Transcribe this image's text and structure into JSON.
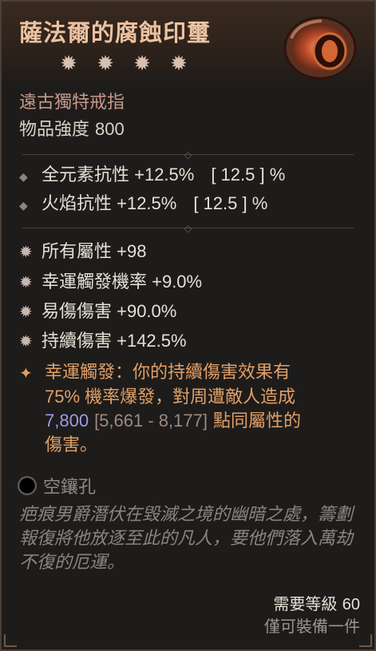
{
  "item": {
    "name": "薩法爾的腐蝕印璽",
    "star_count": 4,
    "type": "遠古獨特戒指",
    "power_label": "物品強度",
    "power_value": "800"
  },
  "implicits": [
    {
      "text": "全元素抗性 +12.5%",
      "range": "[ 12.5 ] %"
    },
    {
      "text": "火焰抗性 +12.5%",
      "range": "[ 12.5 ] %"
    }
  ],
  "affixes": [
    {
      "text": "所有屬性 +98"
    },
    {
      "text": "幸運觸發機率 +9.0%"
    },
    {
      "text": "易傷傷害 +90.0%"
    },
    {
      "text": "持續傷害 +142.5%"
    }
  ],
  "aspect": {
    "lead": "幸運觸發：你的持續傷害效果有",
    "line2": "75% 機率爆發，對周遭敵人造成",
    "damage": "7,800",
    "range": "[5,661 - 8,177]",
    "tail": "點同屬性的",
    "line4": "傷害。"
  },
  "socket": {
    "label": "空鑲孔"
  },
  "lore": "疤痕男爵潛伏在毀滅之境的幽暗之處，籌劃報復將他放逐至此的凡人，要他們落入萬劫不復的厄運。",
  "footer": {
    "level_label": "需要等級",
    "level_value": "60",
    "unique_note": "僅可裝備一件"
  },
  "colors": {
    "title": "#ecc2a0",
    "type": "#c6998a",
    "aspect": "#e0a068",
    "damage": "#9a9ce8"
  }
}
